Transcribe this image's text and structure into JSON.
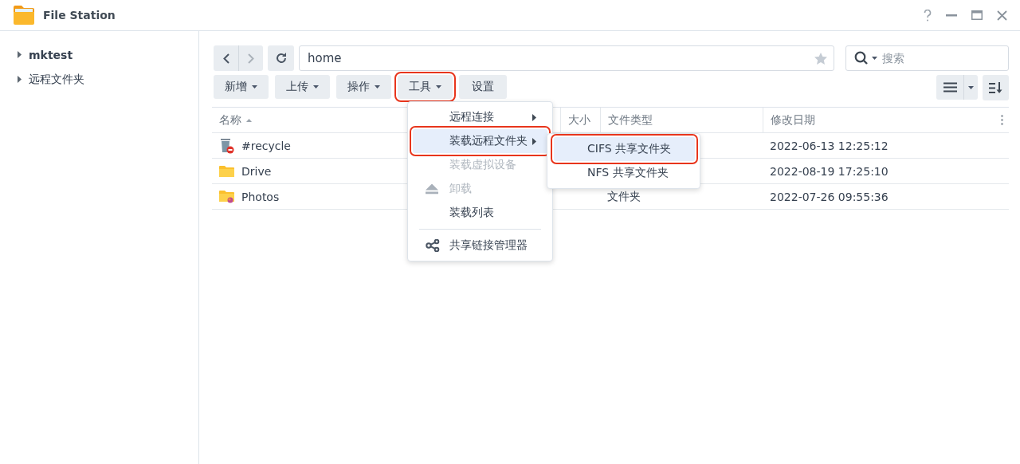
{
  "window": {
    "title": "File Station"
  },
  "sidebar": {
    "items": [
      {
        "label": "mktest",
        "bold": true
      },
      {
        "label": "远程文件夹",
        "bold": false
      }
    ]
  },
  "path": {
    "value": "home"
  },
  "search": {
    "placeholder": "搜索"
  },
  "toolbar": [
    {
      "label": "新增",
      "dropdown": true,
      "highlighted": false
    },
    {
      "label": "上传",
      "dropdown": true,
      "highlighted": false
    },
    {
      "label": "操作",
      "dropdown": true,
      "highlighted": false
    },
    {
      "label": "工具",
      "dropdown": true,
      "highlighted": true
    },
    {
      "label": "设置",
      "dropdown": false,
      "highlighted": false
    }
  ],
  "table": {
    "columns": [
      {
        "label": "名称",
        "sorted": true
      },
      {
        "label": "大小",
        "sorted": false
      },
      {
        "label": "文件类型",
        "sorted": false
      },
      {
        "label": "修改日期",
        "sorted": false
      }
    ],
    "rows": [
      {
        "kind": "recycle",
        "name": "#recycle",
        "modified": "2022-06-13 12:25:12"
      },
      {
        "kind": "folder",
        "name": "Drive",
        "modified": "2022-08-19 17:25:10"
      },
      {
        "kind": "photos",
        "name": "Photos",
        "type": "文件夹",
        "modified": "2022-07-26 09:55:36"
      }
    ]
  },
  "menu": {
    "items": [
      {
        "kind": "item",
        "label": "远程连接",
        "submenu": true,
        "disabled": false,
        "highlighted": false
      },
      {
        "kind": "item",
        "label": "装载远程文件夹",
        "submenu": true,
        "disabled": false,
        "highlighted": true
      },
      {
        "kind": "item",
        "label": "装载虚拟设备",
        "submenu": false,
        "disabled": true,
        "highlighted": false
      },
      {
        "kind": "eject",
        "label": "卸载",
        "submenu": false,
        "disabled": true,
        "highlighted": false
      },
      {
        "kind": "item",
        "label": "装载列表",
        "submenu": false,
        "disabled": false,
        "highlighted": false
      },
      {
        "kind": "separator"
      },
      {
        "kind": "share",
        "label": "共享链接管理器",
        "submenu": false,
        "disabled": false,
        "highlighted": false
      }
    ]
  },
  "submenu": {
    "items": [
      {
        "label": "CIFS 共享文件夹",
        "selected": true
      },
      {
        "label": "NFS 共享文件夹",
        "selected": false
      }
    ]
  }
}
